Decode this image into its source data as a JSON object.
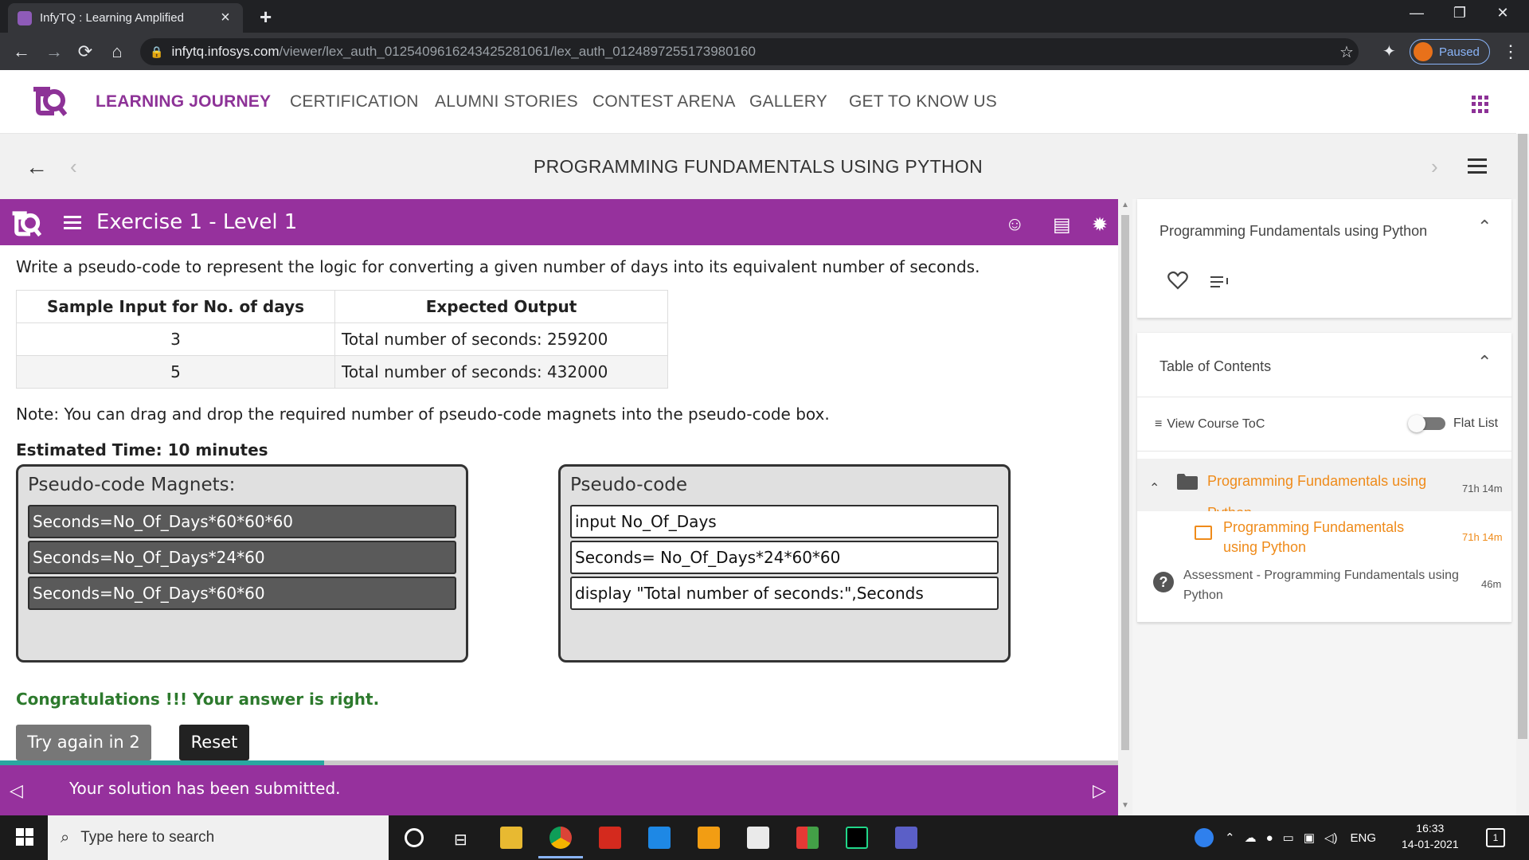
{
  "browser": {
    "tab_title": "InfyTQ : Learning Amplified",
    "url_domain": "infytq.infosys.com",
    "url_path": "/viewer/lex_auth_01254096162434252810​61/lex_auth_0124897255173980160",
    "profile_status": "Paused"
  },
  "site": {
    "nav": [
      "LEARNING JOURNEY",
      "CERTIFICATION",
      "ALUMNI STORIES",
      "CONTEST ARENA",
      "GALLERY",
      "GET TO KNOW US"
    ],
    "course_title": "PROGRAMMING FUNDAMENTALS USING PYTHON"
  },
  "exercise": {
    "title": "Exercise 1 - Level 1",
    "prompt": "Write a pseudo-code to represent the logic for converting a given number of days into its equivalent number of seconds.",
    "table": {
      "headers": [
        "Sample Input for No. of days",
        "Expected Output"
      ],
      "rows": [
        [
          "3",
          "Total number of seconds: 259200"
        ],
        [
          "5",
          "Total number of seconds: 432000"
        ]
      ]
    },
    "note": "Note: You can drag and drop the required number of pseudo-code magnets into the pseudo-code box.",
    "estimated_time": "Estimated Time: 10 minutes",
    "magnets_title": "Pseudo-code Magnets:",
    "magnets": [
      "Seconds=No_Of_Days*60*60*60",
      "Seconds=No_Of_Days*24*60",
      "Seconds=No_Of_Days*60*60"
    ],
    "code_title": "Pseudo-code",
    "code_lines": [
      "input No_Of_Days",
      "Seconds= No_Of_Days*24*60*60",
      "display \"Total number of seconds:\",Seconds"
    ],
    "result": "Congratulations !!! Your answer is right.",
    "try_again": "Try again in 2",
    "reset": "Reset",
    "footer_msg": "Your solution has been submitted.",
    "progress_fraction": 0.29
  },
  "side_panel": {
    "course_card_title": "Programming Fundamentals using Python",
    "toc_title": "Table of Contents",
    "view_toc": "View Course ToC",
    "flat_list": "Flat List",
    "items": [
      {
        "label": "Programming Fundamentals using Python",
        "duration": "71h 14m"
      },
      {
        "label": "Programming Fundamentals using Python",
        "duration": "71h 14m"
      },
      {
        "label": "Assessment - Programming Fundamentals using Python",
        "duration": "46m"
      }
    ]
  },
  "taskbar": {
    "search_placeholder": "Type here to search",
    "lang": "ENG",
    "time": "16:33",
    "date": "14-01-2021",
    "notifications": "1"
  },
  "colors": {
    "brand_purple": "#96319d",
    "accent_orange": "#ef8b1a",
    "success_green": "#2d7a2d"
  }
}
